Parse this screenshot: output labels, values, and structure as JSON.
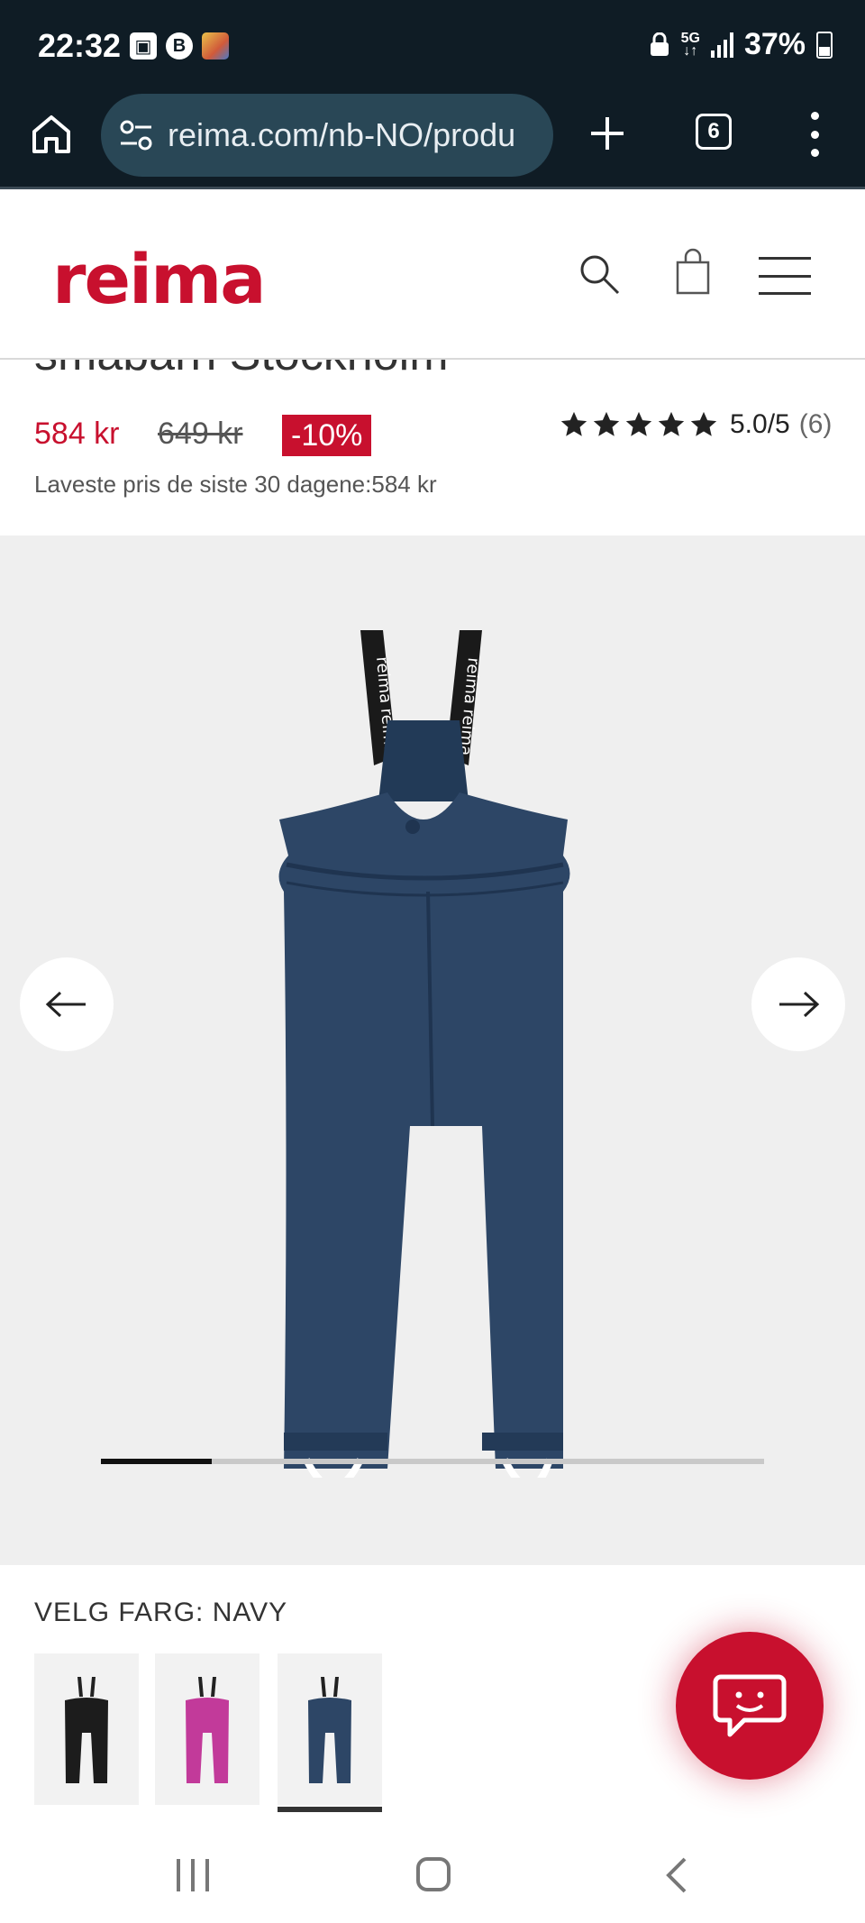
{
  "status_bar": {
    "time": "22:32",
    "network": "5G",
    "battery": "37%",
    "left_icons": [
      "gallery-icon",
      "b-app-icon",
      "app-thumbnail-icon"
    ],
    "b_letter": "B"
  },
  "browser": {
    "url": "reima.com/nb-NO/produ",
    "tab_count": "6"
  },
  "site": {
    "logo": "reima"
  },
  "product": {
    "title_fragment": "småbarn Stockholm",
    "price": "584 kr",
    "old_price": "649 kr",
    "discount": "-10%",
    "rating": "5.0/5",
    "review_count": "(6)",
    "stars": 5,
    "lowest_price_note": "Laveste pris de siste 30 dagene:584 kr"
  },
  "gallery": {
    "progress_fraction": 0.167,
    "product_color": "#2d4666"
  },
  "colors": {
    "label": "VELG FARG: NAVY",
    "swatches": [
      {
        "color": "#1c1c1c",
        "selected": false
      },
      {
        "color": "#c23a9a",
        "selected": false
      },
      {
        "color": "#2d4666",
        "selected": true
      }
    ]
  },
  "theme": {
    "brand_red": "#c8102e",
    "browser_bg": "#0f1c25"
  }
}
